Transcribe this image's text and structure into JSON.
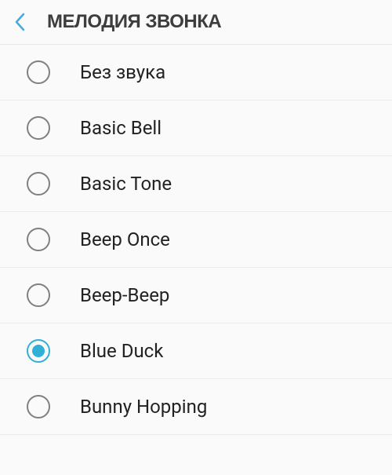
{
  "header": {
    "title": "МЕЛОДИЯ ЗВОНКА"
  },
  "ringtones": [
    {
      "label": "Без звука",
      "selected": false
    },
    {
      "label": "Basic Bell",
      "selected": false
    },
    {
      "label": "Basic Tone",
      "selected": false
    },
    {
      "label": "Beep Once",
      "selected": false
    },
    {
      "label": "Beep-Beep",
      "selected": false
    },
    {
      "label": "Blue Duck",
      "selected": true
    },
    {
      "label": "Bunny Hopping",
      "selected": false
    }
  ],
  "colors": {
    "accent": "#31b0d5"
  }
}
